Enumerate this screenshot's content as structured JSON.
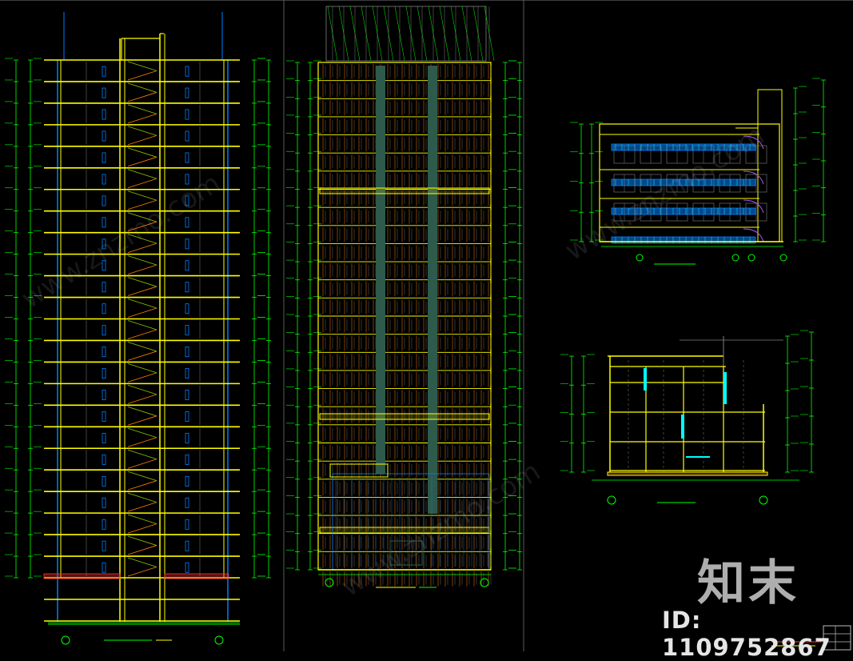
{
  "watermark": {
    "logo_text": "知末",
    "id_text": "ID: 1109752867",
    "site_text": "www.znzmo.com"
  },
  "colors": {
    "background": "#000000",
    "structure": "#ffff00",
    "dimension": "#00ff00",
    "axis": "#00ffff",
    "glass": "#0080ff",
    "detail": "#ff8000",
    "hatch": "#ff3333",
    "grid": "#808080",
    "wall_fill": "#2d5a4a"
  },
  "drawings": [
    {
      "name": "section-1",
      "floors": 24
    },
    {
      "name": "elevation-main",
      "floors": 28
    },
    {
      "name": "elevation-small",
      "floors": 4
    },
    {
      "name": "section-small",
      "floors": 4
    }
  ]
}
